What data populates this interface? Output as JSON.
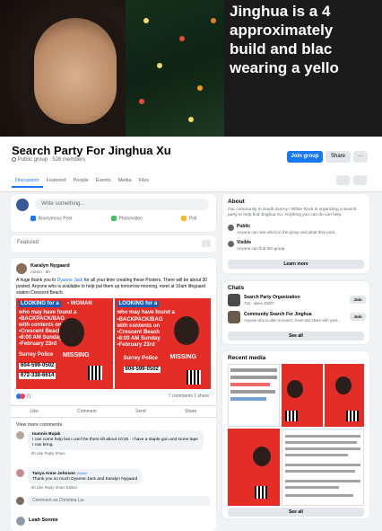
{
  "banner": {
    "caption_lines": [
      "Jinghua is a 4",
      "approximately",
      "build and blac",
      "wearing a yello"
    ]
  },
  "group": {
    "title": "Search Party For Jinghua Xu",
    "meta": "Public group · 526 members",
    "join_label": "Join group",
    "share_label": "Share",
    "more_label": "···"
  },
  "tabs": [
    "Discussion",
    "Featured",
    "People",
    "Events",
    "Media",
    "Files"
  ],
  "compose": {
    "placeholder": "Write something...",
    "actions": [
      "Anonymous Post",
      "Photo/video",
      "Poll"
    ]
  },
  "featured": {
    "label": "Featured"
  },
  "post": {
    "author": "Karalyn Nygaard",
    "meta": "Admin · 6h · ",
    "text_before": "A huge thank you to ",
    "mention": "Dyanne Jack",
    "text_after": " for all your time creating these Posters. There will be about 30 posted. Anyone who is available to help put them up tomorrow morning, meet at 10am lifeguard station Crescent Beach.",
    "poster_lines": [
      "LOOKING for a",
      "who may have found a",
      "•BACKPACK/BAG",
      "with contents on",
      "•Crescent Beach",
      "•8:00 AM Sunday",
      "•February 23rd"
    ],
    "poster_police": "Surrey Police",
    "poster_phone1": "604-599-0502",
    "poster_phone2": "672-338-6614",
    "missing": "MISSING",
    "woman": "• WOMAN",
    "reactions": "21",
    "comments_shares": "7 comments  1 share",
    "actions": [
      "Like",
      "Comment",
      "Send",
      "Share"
    ],
    "view_more": "View more comments",
    "comments": [
      {
        "name": "Ioannis Bujak",
        "text": "I can come help but I can't be there till about 10:30 . I have a staple gun and some tape I can bring.",
        "sub": "6h   Like   Reply   Share"
      },
      {
        "name": "Tanya Anne Johnson",
        "badge": "Admin",
        "text": "Thank you so much Dyanne Jack and Karalyn Nygaard",
        "sub": "6h   Like   Reply   Share   Edited"
      }
    ],
    "comment_placeholder": "Comment as Christina Liu"
  },
  "next_post": {
    "author": "Leah Sonnie"
  },
  "about": {
    "title": "About",
    "text": "Our community in South Surrey / White Rock is organizing a search party to help find Jinghua Xu. Anything you can do can help.",
    "public_title": "Public",
    "public_desc": "Anyone can see who's in the group and what they post.",
    "visible_title": "Visible",
    "visible_desc": "Anyone can find this group.",
    "learn_more": "Learn more"
  },
  "chats": {
    "title": "Chats",
    "items": [
      {
        "name": "Search Party Organization",
        "desc": "716 · alone 2020?",
        "join": "Join"
      },
      {
        "name": "Community Search For Jinghua",
        "desc": "Anyone who is able to search, meet and share with your...",
        "join": "Join"
      }
    ],
    "see_all": "See all"
  },
  "media": {
    "title": "Recent media",
    "see_all": "See all"
  }
}
